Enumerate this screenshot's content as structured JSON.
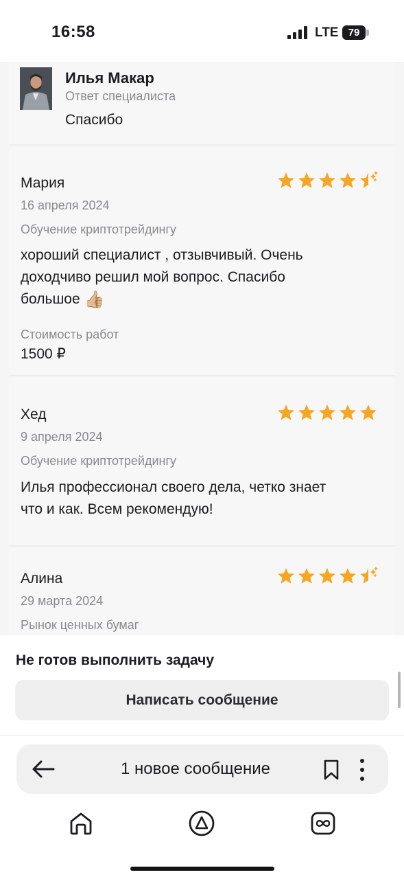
{
  "status_bar": {
    "time": "16:58",
    "network": "LTE",
    "battery": "79"
  },
  "reply": {
    "name": "Илья Макар",
    "role": "Ответ специалиста",
    "text": "Спасибо"
  },
  "reviews": [
    {
      "author": "Мария",
      "date": "16 апреля 2024",
      "service": "Обучение криптотрейдингу",
      "text_line1": "хороший специалист , отзывчивый. Очень",
      "text_line2": "доходчиво решил мой вопрос. Спасибо",
      "text_line3": "большое",
      "emoji": "👍🏼",
      "rating": 4.5,
      "cost_label": "Стоимость работ",
      "cost": "1500 ₽"
    },
    {
      "author": "Хед",
      "date": "9 апреля 2024",
      "service": "Обучение криптотрейдингу",
      "text_line1": "Илья профессионал своего дела, четко знает",
      "text_line2": "что и как. Всем рекомендую!",
      "rating": 5
    },
    {
      "author": "Алина",
      "date": "29 марта 2024",
      "service": "Рынок ценных бумаг",
      "rating": 4.5
    }
  ],
  "sheet": {
    "note": "Не готов выполнить задачу",
    "button": "Написать сообщение"
  },
  "browser": {
    "title": "1 новое сообщение"
  },
  "colors": {
    "star": "#f5a623",
    "text": "#1c1c1e",
    "muted": "#8a8a8e"
  },
  "icons": [
    "back-arrow-icon",
    "bookmark-icon",
    "more-vertical-icon",
    "home-icon",
    "alice-icon",
    "tabs-icon"
  ]
}
